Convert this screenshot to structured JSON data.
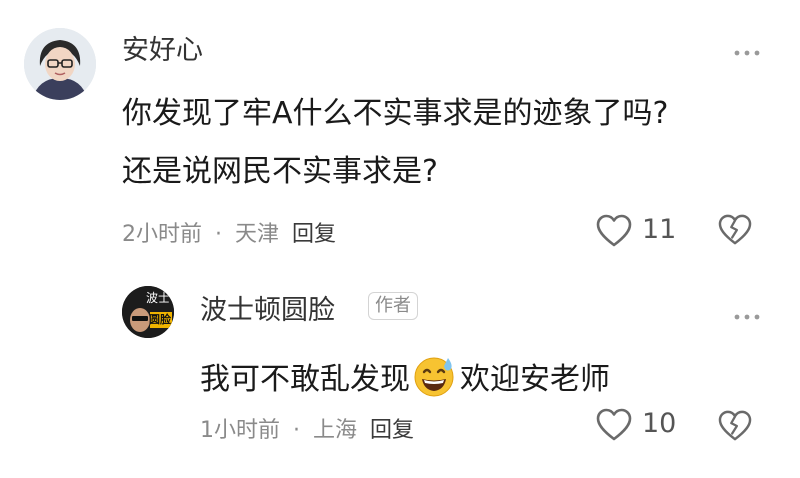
{
  "comment": {
    "author": "安好心",
    "text_line1": "你发现了牢A什么不实事求是的迹象了吗?",
    "text_line2": "还是说网民不实事求是?",
    "time": "2小时前",
    "separator": "·",
    "location": "天津",
    "reply_label": "回复",
    "like_count": "11",
    "more_icon": "ellipsis-icon",
    "like_icon": "heart-outline-icon",
    "dislike_icon": "broken-heart-icon"
  },
  "reply": {
    "author": "波士顿圆脸",
    "author_badge": "作者",
    "text_before_emoji": "我可不敢乱发现",
    "emoji_icon": "grinning-sweat-emoji",
    "text_after_emoji": "欢迎安老师",
    "time": "1小时前",
    "separator": "·",
    "location": "上海",
    "reply_label": "回复",
    "like_count": "10",
    "avatar_text_top": "波士",
    "avatar_text_bottom": "圆脸",
    "more_icon": "ellipsis-icon",
    "like_icon": "heart-outline-icon",
    "dislike_icon": "broken-heart-icon"
  }
}
